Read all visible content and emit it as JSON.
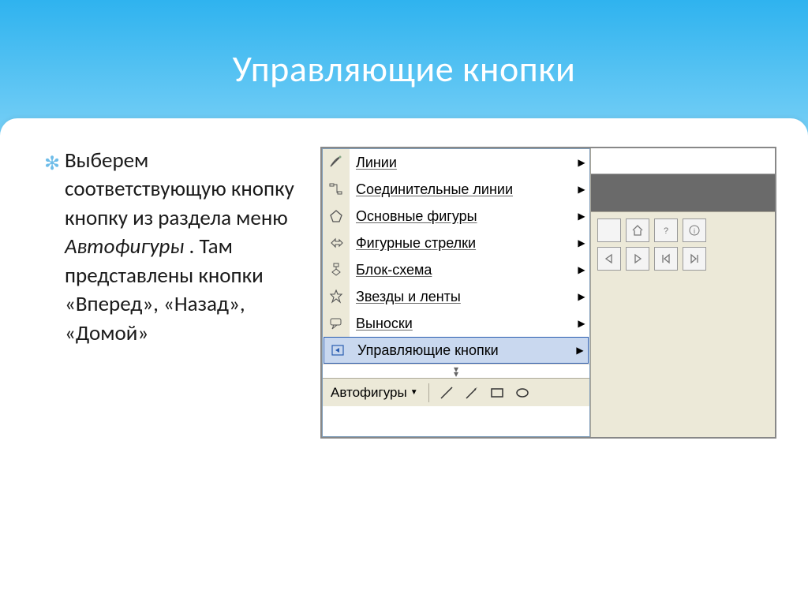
{
  "slide": {
    "title": "Управляющие кнопки",
    "body_pre": "Выберем соответствующую кнопку кнопку из раздела меню ",
    "body_em": "Автофигуры",
    "body_post": " . Там представлены кнопки «Вперед», «Назад», «Домой»"
  },
  "menu": {
    "items": [
      {
        "label": "Линии",
        "icon": "lines-icon"
      },
      {
        "label": "Соединительные линии",
        "icon": "connectors-icon"
      },
      {
        "label": "Основные фигуры",
        "icon": "basic-shapes-icon"
      },
      {
        "label": "Фигурные стрелки",
        "icon": "block-arrows-icon"
      },
      {
        "label": "Блок-схема",
        "icon": "flowchart-icon"
      },
      {
        "label": "Звезды и ленты",
        "icon": "stars-icon"
      },
      {
        "label": "Выноски",
        "icon": "callouts-icon"
      },
      {
        "label": "Управляющие кнопки",
        "icon": "action-buttons-icon"
      }
    ],
    "selected_index": 7,
    "toolbar_label": "Автофигуры"
  },
  "action_buttons_grid": {
    "rows": 2,
    "cols": 4,
    "cells": [
      "blank",
      "home",
      "help",
      "info",
      "back",
      "forward",
      "beginning",
      "end"
    ]
  }
}
